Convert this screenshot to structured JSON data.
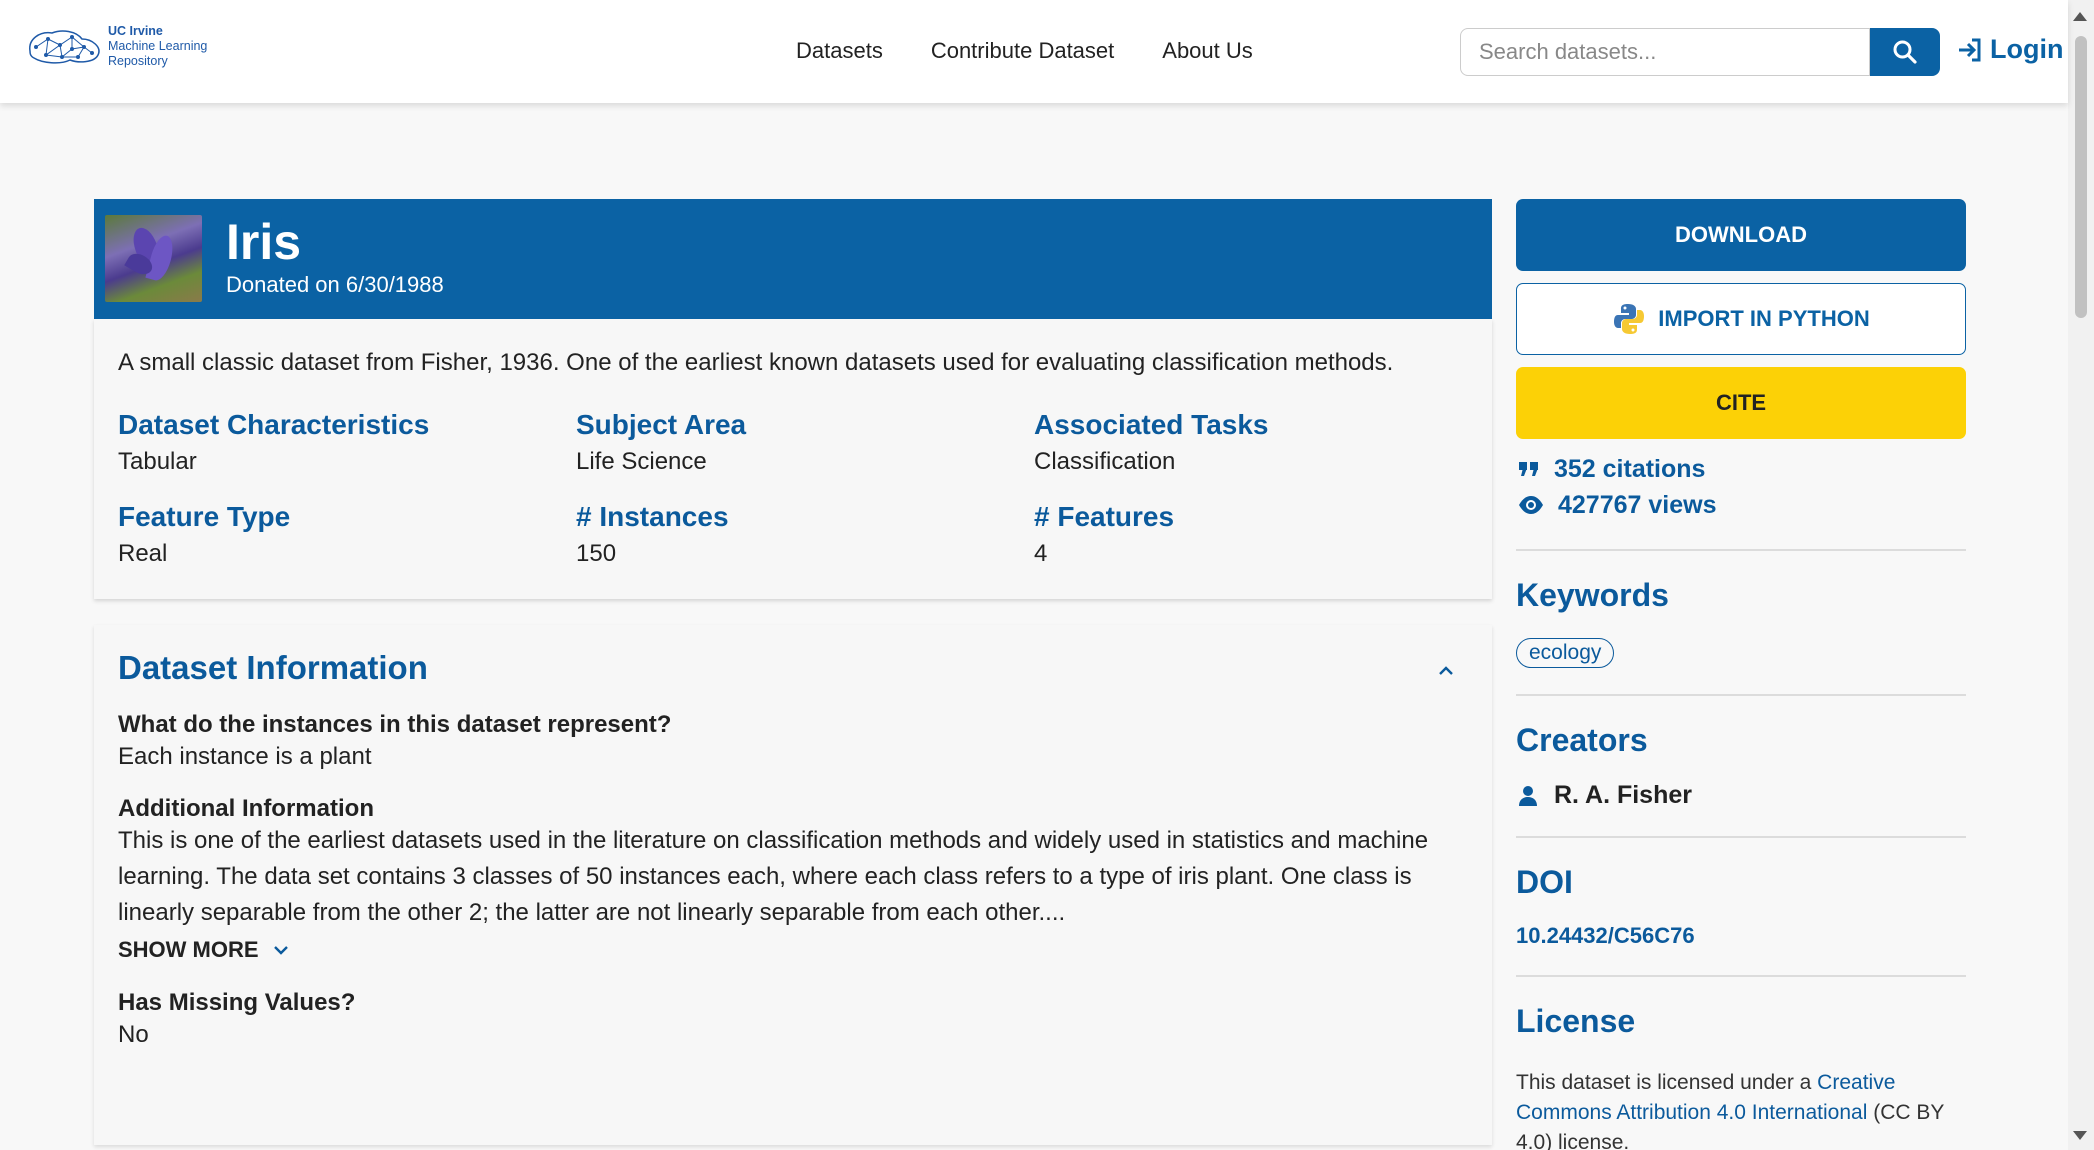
{
  "header": {
    "logo_line1": "UC Irvine",
    "logo_line2": "Machine Learning",
    "logo_line3": "Repository",
    "nav": [
      "Datasets",
      "Contribute Dataset",
      "About Us"
    ],
    "search_placeholder": "Search datasets...",
    "login_label": "Login"
  },
  "dataset": {
    "title": "Iris",
    "donated": "Donated on 6/30/1988",
    "description": "A small classic dataset from Fisher, 1936. One of the earliest known datasets used for evaluating classification methods.",
    "attributes": [
      {
        "label": "Dataset Characteristics",
        "value": "Tabular"
      },
      {
        "label": "Subject Area",
        "value": "Life Science"
      },
      {
        "label": "Associated Tasks",
        "value": "Classification"
      },
      {
        "label": "Feature Type",
        "value": "Real"
      },
      {
        "label": "# Instances",
        "value": "150"
      },
      {
        "label": "# Features",
        "value": "4"
      }
    ]
  },
  "info": {
    "title": "Dataset Information",
    "q1": "What do the instances in this dataset represent?",
    "a1": "Each instance is a plant",
    "q2": "Additional Information",
    "a2": "This is one of the earliest datasets used in the literature on classification methods and widely used in statistics and machine learning.  The data set contains 3 classes of 50 instances each, where each class refers to a type of iris plant. One class is linearly separable from the other 2; the latter are not linearly separable from each other....",
    "show_more": "SHOW MORE",
    "q3": "Has Missing Values?",
    "a3": "No"
  },
  "sidebar": {
    "download": "DOWNLOAD",
    "import_python": "IMPORT IN PYTHON",
    "cite": "CITE",
    "citations": "352 citations",
    "views": "427767 views",
    "keywords_title": "Keywords",
    "keyword": "ecology",
    "creators_title": "Creators",
    "creator": "R. A. Fisher",
    "doi_title": "DOI",
    "doi": "10.24432/C56C76",
    "license_title": "License",
    "license_pre": "This dataset is licensed under a ",
    "license_link": "Creative Commons Attribution 4.0 International",
    "license_post": " (CC BY 4.0) license."
  },
  "colors": {
    "brand": "#0b62a4",
    "cite": "#fcd106"
  }
}
